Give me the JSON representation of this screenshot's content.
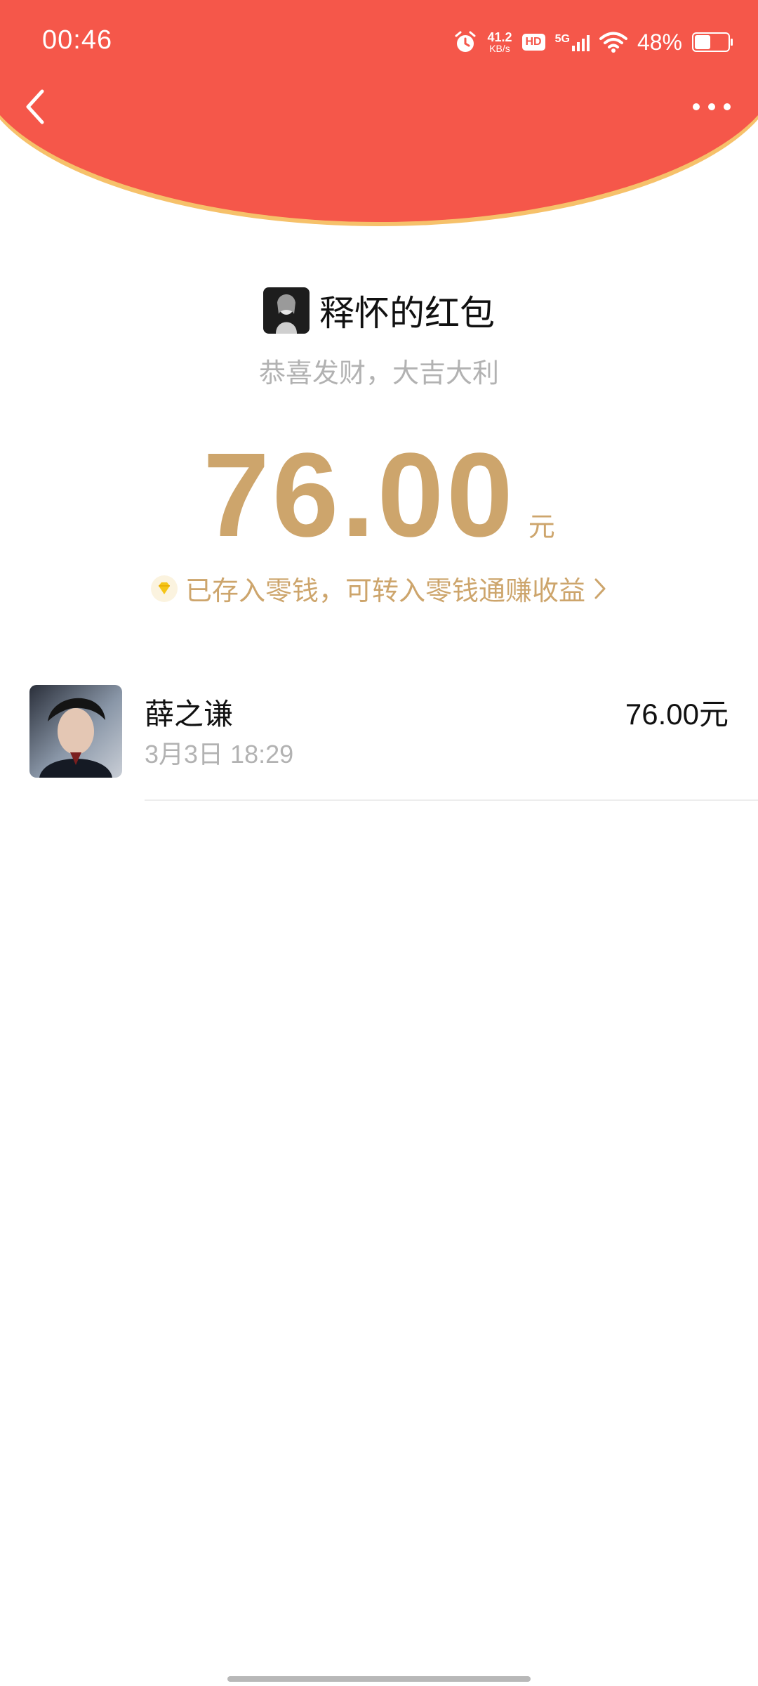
{
  "colors": {
    "header_red": "#f5574a",
    "header_edge_gold": "#f6c16a",
    "gold_text": "#cda56c",
    "muted_text": "#b2b2b2",
    "primary_text": "#111111"
  },
  "status_bar": {
    "time": "00:46",
    "net_speed_value": "41.2",
    "net_speed_unit": "KB/s",
    "hd_badge": "HD",
    "network_type": "5G",
    "battery_percent": "48%",
    "battery_level": 0.48,
    "icons": [
      "alarm-icon",
      "signal-icon",
      "wifi-icon",
      "battery-icon"
    ]
  },
  "nav": {
    "back_icon": "chevron-left-icon",
    "more_icon": "more-dots-icon"
  },
  "envelope": {
    "sender_name": "释怀的红包",
    "greeting": "恭喜发财，大吉大利",
    "amount": "76.00",
    "currency_unit": "元",
    "wallet_note": "已存入零钱，可转入零钱通赚收益",
    "wallet_note_icon": "diamond-icon"
  },
  "records": [
    {
      "name": "薛之谦",
      "time": "3月3日  18:29",
      "amount": "76.00元"
    }
  ]
}
